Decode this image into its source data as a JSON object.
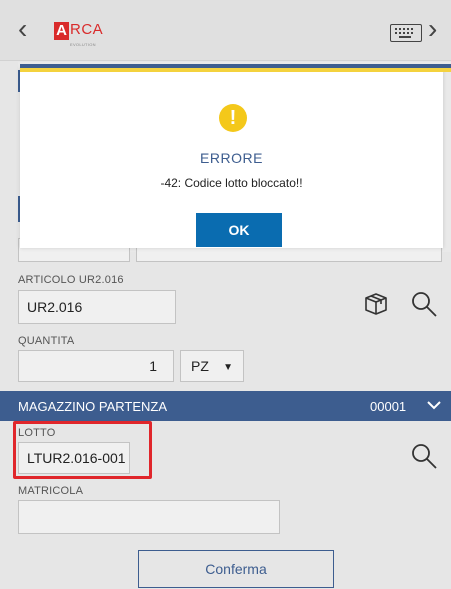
{
  "header": {
    "back_glyph": "‹",
    "forward_glyph": "›",
    "logo_letter": "A",
    "logo_text": "RCA",
    "logo_subtext": "EVOLUTION",
    "icons": {
      "back": "chevron-left-icon",
      "keyboard": "keyboard-icon",
      "forward": "chevron-right-icon"
    }
  },
  "modal": {
    "title": "ERRORE",
    "message": "-42: Codice lotto bloccato!!",
    "ok_label": "OK",
    "icon": "warning-icon",
    "icon_glyph": "!"
  },
  "form": {
    "articolo_label": "ARTICOLO  UR2.016",
    "articolo_value": "UR2.016",
    "quantita_label": "QUANTITA",
    "quantita_value": "1",
    "unit_value": "PZ",
    "unit_caret": "▼",
    "section_title": "MAGAZZINO PARTENZA",
    "section_code": "00001",
    "lotto_label": "LOTTO",
    "lotto_value": "LTUR2.016-001",
    "matricola_label": "MATRICOLA",
    "matricola_value": "",
    "confirm_label": "Conferma"
  },
  "colors": {
    "accent_blue": "#3d5d8f",
    "ok_blue": "#0a6cb0",
    "warning_yellow": "#f4c81a",
    "highlight_red": "#e0262b",
    "logo_red": "#d92b2b"
  }
}
